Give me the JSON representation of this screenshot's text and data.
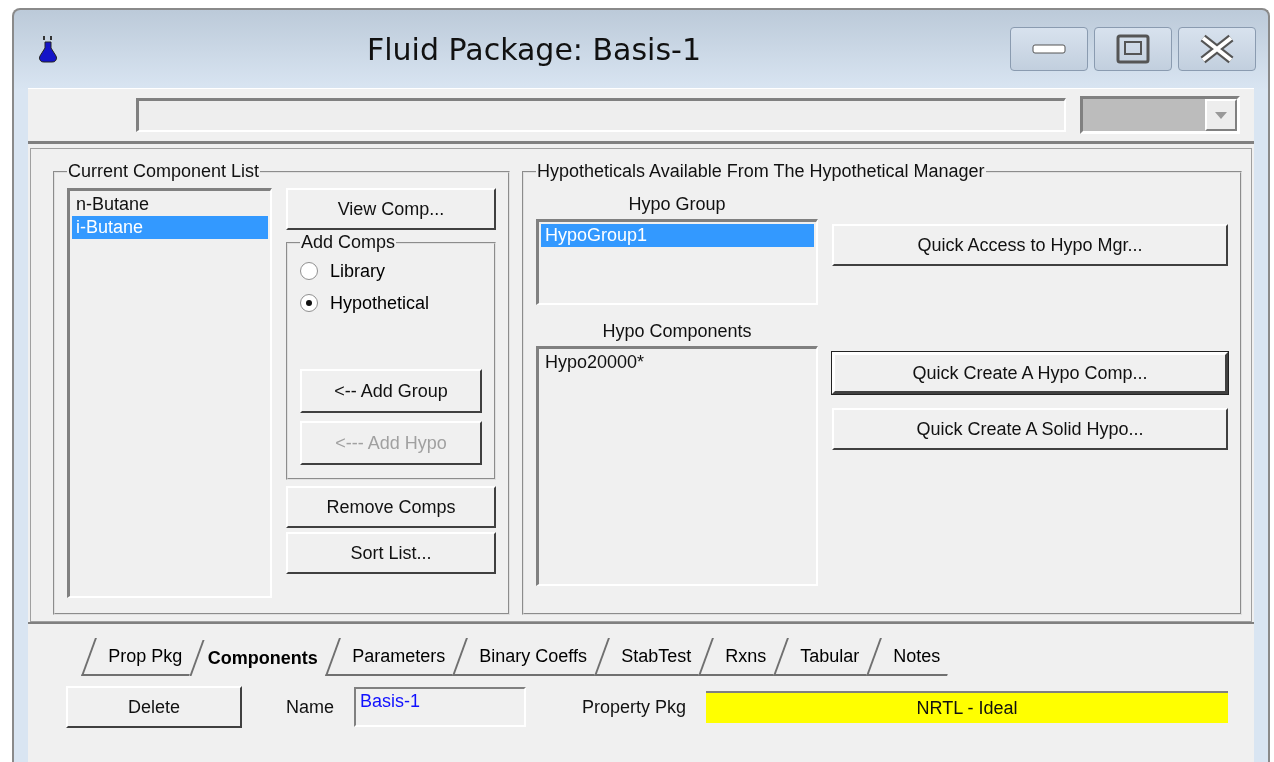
{
  "window": {
    "title": "Fluid Package: Basis-1"
  },
  "component_list": {
    "title": "Current Component List",
    "items": [
      {
        "label": "n-Butane",
        "selected": false
      },
      {
        "label": "i-Butane",
        "selected": true
      }
    ]
  },
  "view_button": {
    "label": "View Comp..."
  },
  "add_comps": {
    "title": "Add Comps",
    "options": [
      {
        "label": "Library",
        "selected": false
      },
      {
        "label": "Hypothetical",
        "selected": true
      }
    ],
    "buttons": [
      {
        "label": "<-- Add Group",
        "disabled": false
      },
      {
        "label": "<--- Add Hypo",
        "disabled": true
      }
    ]
  },
  "list_buttons": [
    {
      "label": "Remove Comps"
    },
    {
      "label": "Sort List..."
    }
  ],
  "hypotheticals": {
    "title": "Hypotheticals Available From The Hypothetical Manager",
    "hypo_group": {
      "label": "Hypo Group",
      "items": [
        {
          "label": "HypoGroup1",
          "selected": true
        }
      ]
    },
    "hypo_components": {
      "label": "Hypo Components",
      "items": [
        {
          "label": "Hypo20000*",
          "selected": false
        }
      ]
    },
    "buttons": [
      {
        "label": "Quick Access to Hypo Mgr...",
        "focused": false
      },
      {
        "label": "Quick Create A Hypo Comp...",
        "focused": true
      },
      {
        "label": "Quick Create A Solid Hypo...",
        "focused": false
      }
    ]
  },
  "tabs": [
    {
      "label": "Prop Pkg",
      "selected": false
    },
    {
      "label": "Components",
      "selected": true
    },
    {
      "label": "Parameters",
      "selected": false
    },
    {
      "label": "Binary Coeffs",
      "selected": false
    },
    {
      "label": "StabTest",
      "selected": false
    },
    {
      "label": "Rxns",
      "selected": false
    },
    {
      "label": "Tabular",
      "selected": false
    },
    {
      "label": "Notes",
      "selected": false
    }
  ],
  "footer": {
    "delete_button": "Delete",
    "name_label": "Name",
    "name_value": "Basis-1",
    "property_pkg_label": "Property Pkg",
    "property_pkg_value": "NRTL - Ideal"
  }
}
